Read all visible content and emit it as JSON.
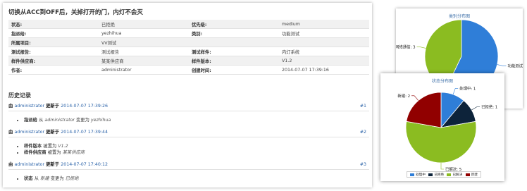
{
  "bug": {
    "title": "切换从ACC到OFF后，关掉打开的门，内灯不会灭",
    "fields": [
      {
        "k1": "状态:",
        "v1": "已拒绝",
        "k2": "优先级:",
        "v2": "medium"
      },
      {
        "k1": "指派给:",
        "v1": "yezhihua",
        "k2": "类别:",
        "v2": "功能测试"
      },
      {
        "k1": "所属项目:",
        "v1": "VV测试",
        "k2": "",
        "v2": ""
      },
      {
        "k1": "测试报告:",
        "v1": "测试报告",
        "k2": "测试样件:",
        "v2": "内灯系统"
      },
      {
        "k1": "样件供应商:",
        "v1": "某某供应商",
        "k2": "样件版本:",
        "v2": "V1.2"
      },
      {
        "k1": "作者:",
        "v1": "administrator",
        "k2": "创建时间:",
        "v2": "2014-07-07 17:39:16"
      }
    ]
  },
  "history": {
    "title": "历史记录",
    "entries": [
      {
        "by": "由",
        "user": "administrator",
        "updated": "更新于",
        "time": "2014-07-07 17:39:26",
        "num": "#1",
        "changes": [
          {
            "field": "指派给",
            "from": "从",
            "old": "administrator",
            "to": "变更为",
            "new": "yezhihua"
          }
        ]
      },
      {
        "by": "由",
        "user": "administrator",
        "updated": "更新于",
        "time": "2014-07-07 17:39:44",
        "num": "#2",
        "changes": [
          {
            "field": "样件版本",
            "from": "",
            "old": "",
            "to": "被置为",
            "new": "V1.2"
          },
          {
            "field": "样件供应商",
            "from": "",
            "old": "",
            "to": "被置为",
            "new": "某某供应商"
          }
        ]
      },
      {
        "by": "由",
        "user": "administrator",
        "updated": "更新于",
        "time": "2014-07-07 17:40:12",
        "num": "#3",
        "changes": [
          {
            "field": "状态",
            "from": "从",
            "old": "新建",
            "to": "变更为",
            "new": "已拒绝"
          }
        ]
      }
    ]
  },
  "colors": {
    "blue": "#2f7ed8",
    "navy": "#0d233a",
    "green": "#8bbc21",
    "darkred": "#910000"
  },
  "chart_data": [
    {
      "type": "pie",
      "title": "类别分布图",
      "categories": [
        "功能测试",
        "网络通信"
      ],
      "values": [
        4,
        3
      ],
      "colors": [
        "#2f7ed8",
        "#8bbc21"
      ],
      "labels": [
        "功能测试: 4",
        "网络通信: 3"
      ]
    },
    {
      "type": "pie",
      "title": "状态分布图",
      "categories": [
        "处理中",
        "已拒绝",
        "已解决",
        "新建"
      ],
      "values": [
        1,
        1,
        5,
        2
      ],
      "colors": [
        "#2f7ed8",
        "#0d233a",
        "#8bbc21",
        "#910000"
      ],
      "labels": [
        "处理中: 1",
        "已拒绝: 1",
        "已解决: 5",
        "新建: 2"
      ],
      "legend": [
        "处理中",
        "已拒绝",
        "已解决",
        "新建"
      ]
    }
  ]
}
